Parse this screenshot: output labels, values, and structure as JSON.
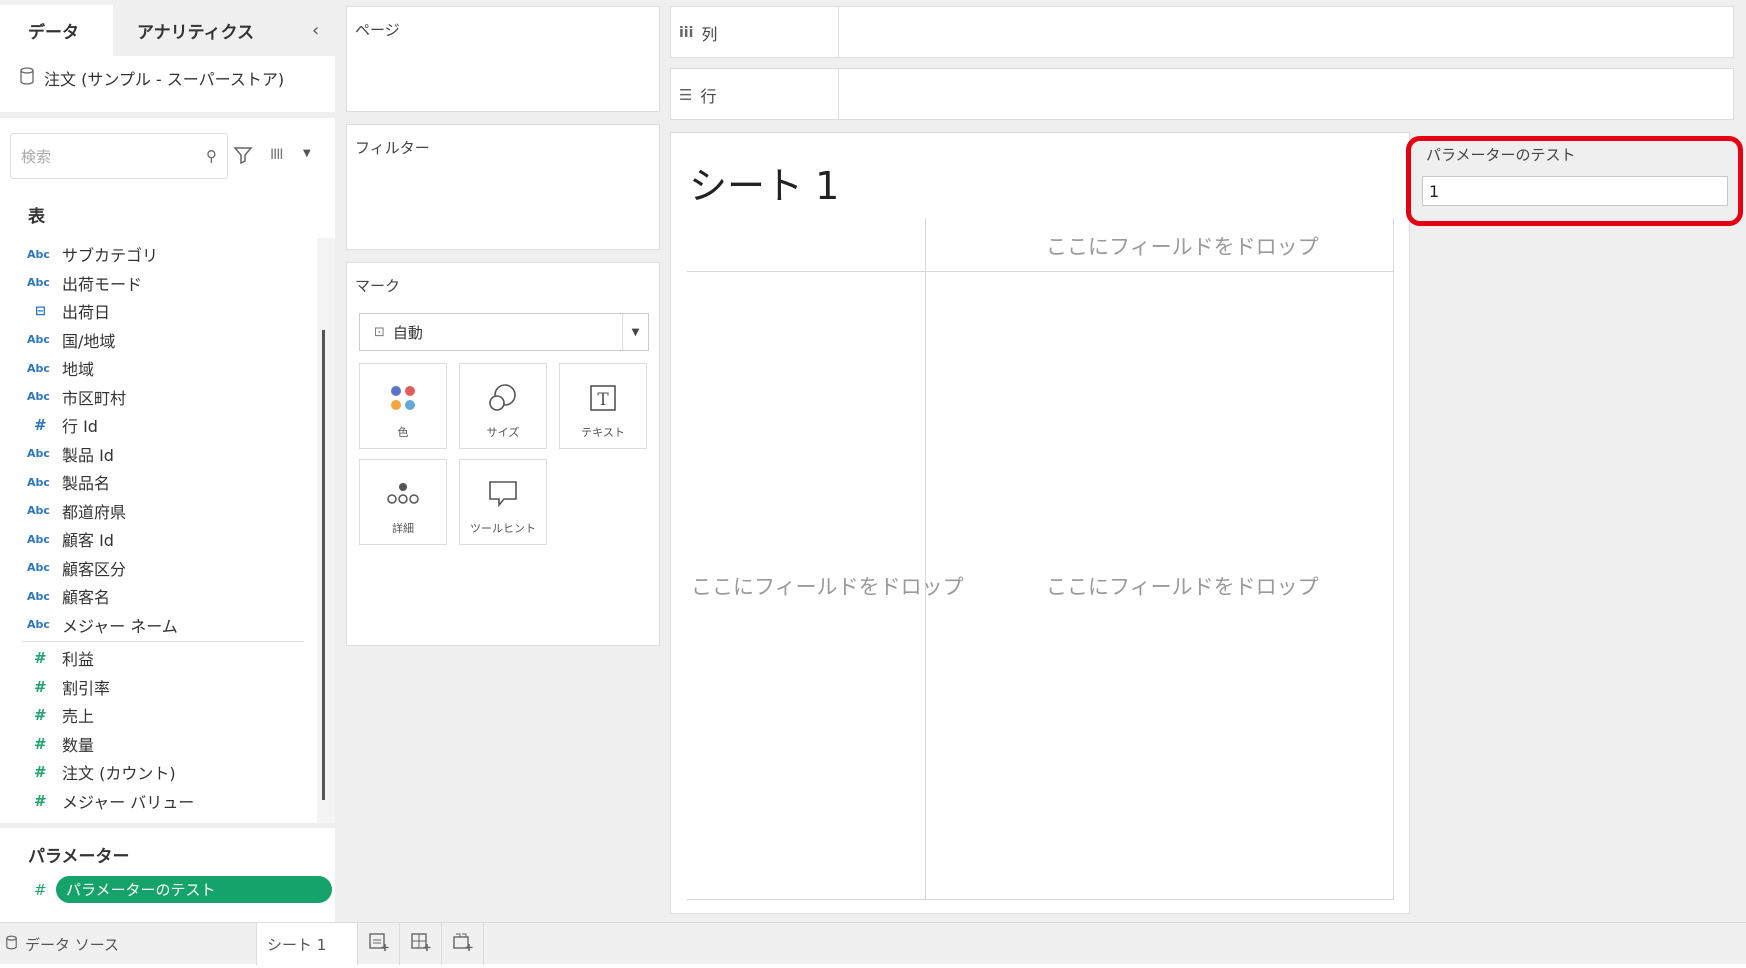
{
  "left_pane": {
    "tabs": [
      "データ",
      "アナリティクス"
    ],
    "datasource": "注文 (サンプル - スーパーストア)",
    "search_placeholder": "検索",
    "table_section_title": "表",
    "dimensions": [
      {
        "type": "abc",
        "label": "サブカテゴリ"
      },
      {
        "type": "abc",
        "label": "出荷モード"
      },
      {
        "type": "date",
        "label": "出荷日"
      },
      {
        "type": "abc",
        "label": "国/地域"
      },
      {
        "type": "abc",
        "label": "地域"
      },
      {
        "type": "abc",
        "label": "市区町村"
      },
      {
        "type": "number",
        "label": "行 Id"
      },
      {
        "type": "abc",
        "label": "製品 Id"
      },
      {
        "type": "abc",
        "label": "製品名"
      },
      {
        "type": "abc",
        "label": "都道府県"
      },
      {
        "type": "abc",
        "label": "顧客 Id"
      },
      {
        "type": "abc",
        "label": "顧客区分"
      },
      {
        "type": "abc",
        "label": "顧客名"
      },
      {
        "type": "abc",
        "label": "メジャー ネーム"
      }
    ],
    "measures": [
      {
        "type": "number",
        "label": "利益"
      },
      {
        "type": "number",
        "label": "割引率"
      },
      {
        "type": "number",
        "label": "売上"
      },
      {
        "type": "number",
        "label": "数量"
      },
      {
        "type": "number",
        "label": "注文 (カウント)"
      },
      {
        "type": "number",
        "label": "メジャー バリュー"
      }
    ],
    "parameters_title": "パラメーター",
    "parameter_item": "パラメーターのテスト",
    "icon_text": {
      "abc": "Abc",
      "date": "⊟",
      "number": "#"
    }
  },
  "shelves": {
    "pages_title": "ページ",
    "filters_title": "フィルター",
    "marks_title": "マーク",
    "marks_type": "自動",
    "mark_buttons": [
      "色",
      "サイズ",
      "テキスト",
      "詳細",
      "ツールヒント"
    ],
    "columns_label": "列",
    "rows_label": "行"
  },
  "sheet": {
    "title": "シート 1",
    "drop_hint": "ここにフィールドをドロップ"
  },
  "parameter_control": {
    "title": "パラメーターのテスト",
    "value": "1"
  },
  "bottom_bar": {
    "datasource_tab": "データ ソース",
    "sheet_tab": "シート 1"
  },
  "colors": {
    "highlight": "#e60012",
    "parameter_pill": "#16a36b",
    "dimension_icon": "#2b77c0",
    "measure_icon": "#20a56f"
  }
}
